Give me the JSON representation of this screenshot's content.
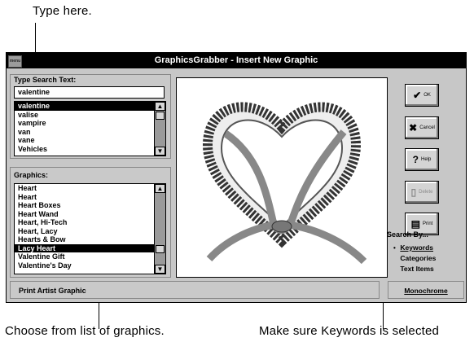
{
  "annotations": {
    "top": "Type here.",
    "bottom_left": "Choose from list of graphics.",
    "bottom_right": "Make sure Keywords is selected"
  },
  "window": {
    "title": "GraphicsGrabber - Insert New Graphic",
    "system_menu": "menu"
  },
  "search": {
    "label": "Type Search Text:",
    "value": "valentine",
    "results": [
      "valentine",
      "valise",
      "vampire",
      "van",
      "vane",
      "Vehicles"
    ],
    "selected_index": 0
  },
  "graphics": {
    "label": "Graphics:",
    "items": [
      "Heart",
      "Heart",
      "Heart Boxes",
      "Heart Wand",
      "Heart, Hi-Tech",
      "Heart, Lacy",
      "Hearts & Bow",
      "Lacy Heart",
      "Valentine Gift",
      "Valentine's Day"
    ],
    "selected_index": 7
  },
  "buttons": {
    "ok": "OK",
    "cancel": "Cancel",
    "help": "Help",
    "delete": "Delete",
    "print": "Print"
  },
  "search_by": {
    "label": "Search By...",
    "options": [
      "Keywords",
      "Categories",
      "Text Items"
    ],
    "selected_index": 0
  },
  "status": {
    "text": "Print Artist Graphic",
    "mono": "Monochrome"
  },
  "icons": {
    "ok": "checkmark-icon",
    "cancel": "x-icon",
    "help": "question-icon",
    "delete": "document-icon",
    "print": "printer-icon"
  }
}
